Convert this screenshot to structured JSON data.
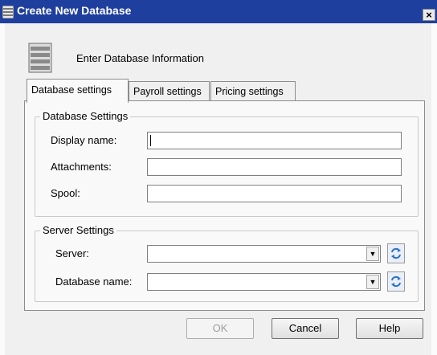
{
  "window": {
    "title": "Create New Database",
    "close_label": "×"
  },
  "header": {
    "text": "Enter Database Information"
  },
  "tabs": [
    {
      "label": "Database settings",
      "active": true
    },
    {
      "label": "Payroll settings",
      "active": false
    },
    {
      "label": "Pricing settings",
      "active": false
    }
  ],
  "database_settings": {
    "legend": "Database Settings",
    "display_name": {
      "label": "Display name:",
      "value": ""
    },
    "attachments": {
      "label": "Attachments:",
      "value": ""
    },
    "spool": {
      "label": "Spool:",
      "value": ""
    }
  },
  "server_settings": {
    "legend": "Server Settings",
    "server": {
      "label": "Server:",
      "value": ""
    },
    "database_name": {
      "label": "Database name:",
      "value": ""
    }
  },
  "buttons": {
    "ok": "OK",
    "cancel": "Cancel",
    "help": "Help"
  },
  "colors": {
    "titlebar": "#1e3f9e",
    "panel": "#f9f9f9",
    "refresh_accent": "#2a72c8"
  }
}
